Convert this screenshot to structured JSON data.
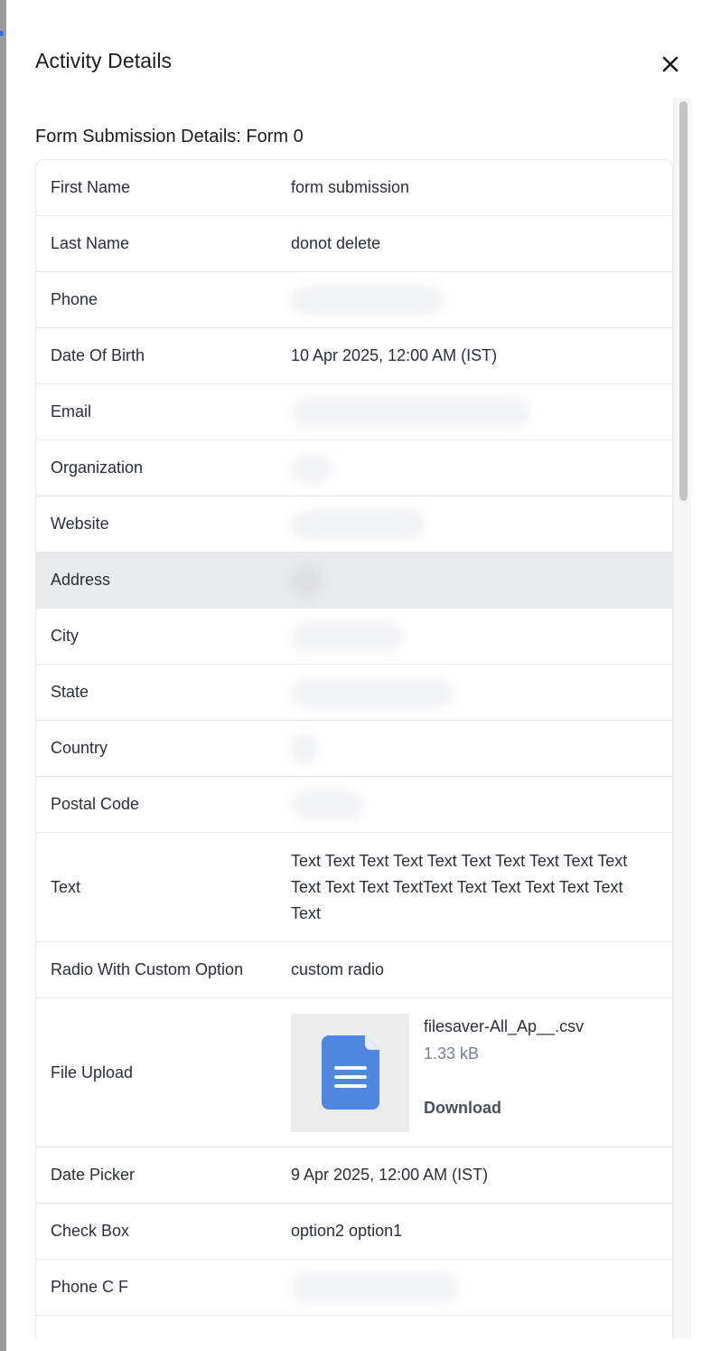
{
  "drawer": {
    "title": "Activity Details",
    "close_icon": "close-icon"
  },
  "form": {
    "section_title": "Form Submission Details: Form 0",
    "rows": [
      {
        "label": "First Name",
        "value": "form submission"
      },
      {
        "label": "Last Name",
        "value": "donot delete"
      },
      {
        "label": "Phone",
        "value": ""
      },
      {
        "label": "Date Of Birth",
        "value": "10 Apr 2025, 12:00 AM (IST)"
      },
      {
        "label": "Email",
        "value": ""
      },
      {
        "label": "Organization",
        "value": ""
      },
      {
        "label": "Website",
        "value": ""
      },
      {
        "label": "Address",
        "value": ""
      },
      {
        "label": "City",
        "value": ""
      },
      {
        "label": "State",
        "value": ""
      },
      {
        "label": "Country",
        "value": ""
      },
      {
        "label": "Postal Code",
        "value": ""
      },
      {
        "label": "Text",
        "value": "Text Text Text Text Text Text Text Text Text Text Text Text Text TextText Text Text Text Text Text Text"
      },
      {
        "label": "Radio With Custom Option",
        "value": "custom radio"
      },
      {
        "label": "File Upload",
        "value": ""
      },
      {
        "label": "Date Picker",
        "value": "9 Apr 2025, 12:00 AM (IST)"
      },
      {
        "label": "Check Box",
        "value": "option2 option1"
      },
      {
        "label": "Phone C F",
        "value": ""
      }
    ],
    "file_upload": {
      "file_name": "filesaver-All_Ap__.csv",
      "file_size": "1.33 kB",
      "download_label": "Download",
      "icon": "document-icon"
    }
  },
  "colors": {
    "doc_icon": "#4f87e0",
    "row_highlight": "#e9eaec",
    "border": "#e6e8eb"
  }
}
